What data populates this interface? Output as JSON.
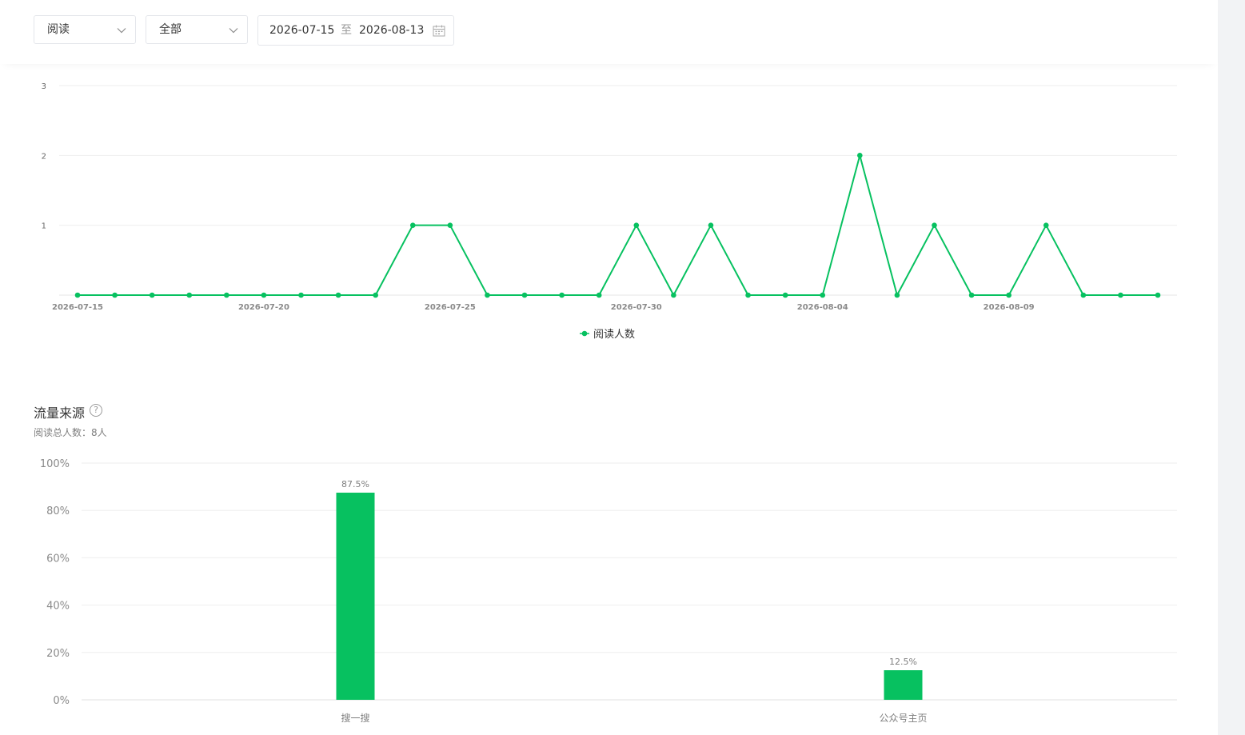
{
  "filters": {
    "metric_select": "阅读",
    "scope_select": "全部",
    "date_start": "2026-07-15",
    "date_separator": "至",
    "date_end": "2026-08-13"
  },
  "traffic_section": {
    "title": "流量来源",
    "total_label": "阅读总人数：8人"
  },
  "chart_data": [
    {
      "type": "line",
      "series": [
        {
          "name": "阅读人数",
          "color": "#07c160",
          "values": [
            0,
            0,
            0,
            0,
            0,
            0,
            0,
            0,
            0,
            1,
            1,
            0,
            0,
            0,
            0,
            1,
            0,
            1,
            0,
            0,
            0,
            2,
            0,
            1,
            0,
            0,
            1,
            0,
            0,
            0
          ]
        }
      ],
      "x": [
        "2026-07-15",
        "2026-07-16",
        "2026-07-17",
        "2026-07-18",
        "2026-07-19",
        "2026-07-20",
        "2026-07-21",
        "2026-07-22",
        "2026-07-23",
        "2026-07-24",
        "2026-07-25",
        "2026-07-26",
        "2026-07-27",
        "2026-07-28",
        "2026-07-29",
        "2026-07-30",
        "2026-07-31",
        "2026-08-01",
        "2026-08-02",
        "2026-08-03",
        "2026-08-04",
        "2026-08-05",
        "2026-08-06",
        "2026-08-07",
        "2026-08-08",
        "2026-08-09",
        "2026-08-10",
        "2026-08-11",
        "2026-08-12",
        "2026-08-13"
      ],
      "x_tick_labels": [
        "2026-07-15",
        "2026-07-20",
        "2026-07-25",
        "2026-07-30",
        "2026-08-04",
        "2026-08-09"
      ],
      "y_ticks": [
        "1",
        "2",
        "3"
      ],
      "ylim": [
        0,
        3
      ],
      "grid": true,
      "legend": "bottom-center"
    },
    {
      "type": "bar",
      "categories": [
        "搜一搜",
        "公众号主页"
      ],
      "values": [
        87.5,
        12.5
      ],
      "value_labels": [
        "87.5%",
        "12.5%"
      ],
      "y_ticks": [
        "0%",
        "20%",
        "40%",
        "60%",
        "80%",
        "100%"
      ],
      "ylim": [
        0,
        100
      ],
      "color": "#07c160",
      "grid": true
    }
  ]
}
